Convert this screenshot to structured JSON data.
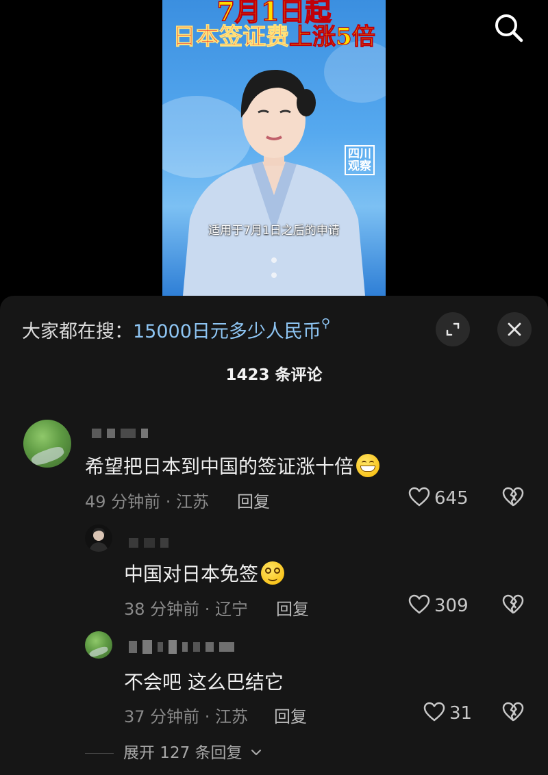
{
  "video": {
    "headline_line1": "7月1日起",
    "headline_part_red": "日本签证费",
    "headline_part_yellow": "上涨5倍",
    "station_logo": "四川\n观察",
    "subtitle": "适用于7月1日之后的申请"
  },
  "top_bar": {
    "search_icon": "search-icon"
  },
  "comments_panel": {
    "hot_search_label": "大家都在搜：",
    "hot_search_query": "15000日元多少人民币",
    "expand_icon": "expand-icon",
    "close_icon": "close-icon",
    "title": "1423 条评论",
    "reply_label": "回复",
    "comments": [
      {
        "text": "希望把日本到中国的签证涨十倍",
        "emoji": "grinning-emoji",
        "meta": "49 分钟前 · 江苏",
        "likes": "645"
      },
      {
        "text": "中国对日本免签",
        "emoji": "dizzy-smile-emoji",
        "meta": "38 分钟前 · 辽宁",
        "likes": "309"
      },
      {
        "text": "不会吧 这么巴结它",
        "meta": "37 分钟前 · 江苏",
        "likes": "31"
      }
    ],
    "expand_replies_label": "展开 127 条回复"
  }
}
